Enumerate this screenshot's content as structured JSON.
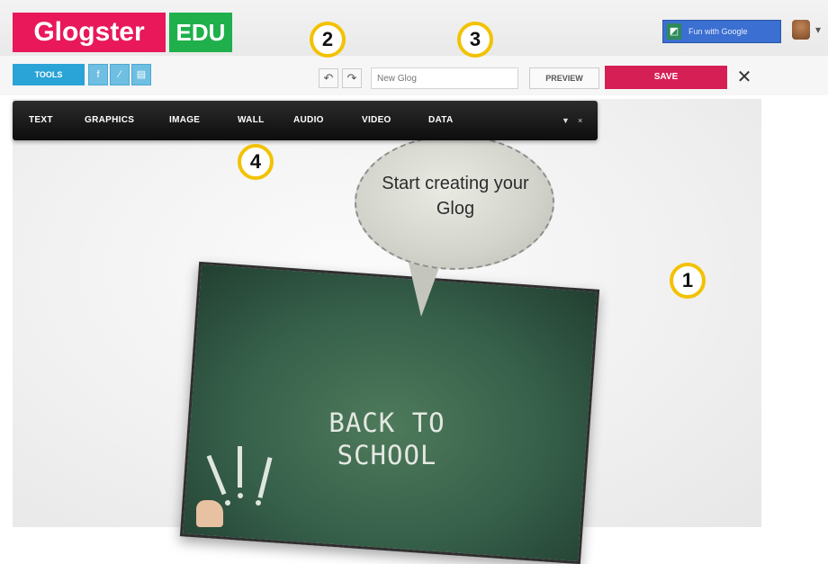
{
  "header": {
    "logo_text": "Glogster",
    "logo_badge": "EDU",
    "brand_color": "#e8185a",
    "badge_color": "#1fb04b",
    "google_button_label": "Fun with Google"
  },
  "toolbar": {
    "tools_label": "TOOLS",
    "glog_title_placeholder": "New Glog",
    "preview_label": "PREVIEW",
    "save_label": "SAVE",
    "save_color": "#d61f55",
    "close_symbol": "✕"
  },
  "menu": {
    "items": [
      "TEXT",
      "GRAPHICS",
      "IMAGE",
      "WALL",
      "AUDIO",
      "VIDEO",
      "DATA"
    ],
    "collapse_symbol": "▼",
    "close_symbol": "×"
  },
  "canvas": {
    "bubble_text": "Start creating your Glog",
    "chalkboard_line1": "BACK TO",
    "chalkboard_line2": "SCHOOL"
  },
  "callouts": [
    "1",
    "2",
    "3",
    "4"
  ],
  "icons": [
    "facebook-icon",
    "link-icon",
    "trash-icon",
    "undo-icon",
    "redo-icon",
    "avatar-icon"
  ]
}
